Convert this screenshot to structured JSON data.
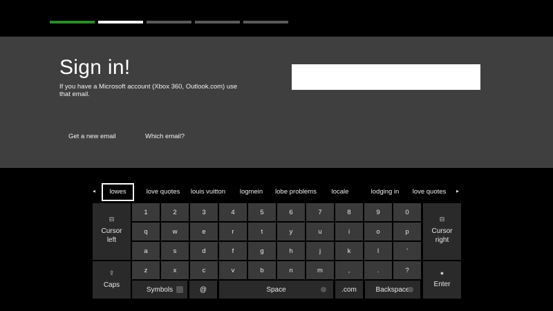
{
  "steps": [
    {
      "state": "done"
    },
    {
      "state": "current"
    },
    {
      "state": "pending"
    },
    {
      "state": "pending"
    },
    {
      "state": "pending"
    }
  ],
  "signin": {
    "title": "Sign in!",
    "description": "If you have a Microsoft account (Xbox 360, Outlook.com) use that email.",
    "link_new_email": "Get a new email",
    "link_which_email": "Which email?",
    "email_value": ""
  },
  "suggestions": {
    "prev_icon": "◂",
    "next_icon": "▸",
    "items": [
      "lowes",
      "love quotes",
      "louis vuitton",
      "logmein",
      "lobe problems",
      "locale",
      "lodging in",
      "love quotes"
    ],
    "selected_index": 0
  },
  "keyboard": {
    "rows": [
      [
        "1",
        "2",
        "3",
        "4",
        "5",
        "6",
        "7",
        "8",
        "9",
        "0"
      ],
      [
        "q",
        "w",
        "e",
        "r",
        "t",
        "y",
        "u",
        "i",
        "o",
        "p"
      ],
      [
        "a",
        "s",
        "d",
        "f",
        "g",
        "h",
        "j",
        "k",
        "l",
        "'"
      ],
      [
        "z",
        "x",
        "c",
        "v",
        "b",
        "n",
        "m",
        ",",
        ".",
        "?"
      ]
    ],
    "cursor_left": {
      "line1": "Cursor",
      "line2": "left",
      "icon": "⊟"
    },
    "cursor_right": {
      "line1": "Cursor",
      "line2": "right",
      "icon": "⊟"
    },
    "caps": {
      "label": "Caps",
      "icon": "⇪"
    },
    "symbols": "Symbols",
    "at": "@",
    "space": "Space",
    "dotcom": ".com",
    "backspace": "Backspace",
    "enter": {
      "label": "Enter",
      "icon": "●"
    }
  }
}
